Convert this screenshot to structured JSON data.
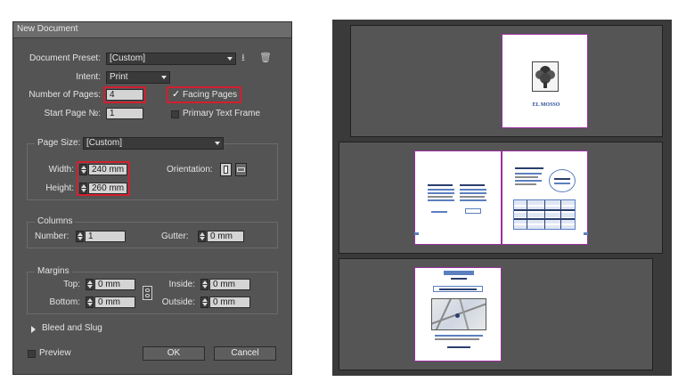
{
  "dialog": {
    "title": "New Document",
    "document_preset": {
      "label": "Document Preset:",
      "value": "[Custom]"
    },
    "intent": {
      "label": "Intent:",
      "value": "Print"
    },
    "number_of_pages": {
      "label": "Number of Pages:",
      "value": "4"
    },
    "facing_pages": {
      "label": "Facing Pages",
      "checked": true
    },
    "start_page": {
      "label": "Start Page №:",
      "value": "1"
    },
    "primary_text_frame": {
      "label": "Primary Text Frame",
      "checked": false
    },
    "page_size": {
      "label": "Page Size:",
      "value": "[Custom]"
    },
    "width": {
      "label": "Width:",
      "value": "240 mm"
    },
    "height": {
      "label": "Height:",
      "value": "260 mm"
    },
    "orientation": {
      "label": "Orientation:"
    },
    "columns": {
      "title": "Columns",
      "number_label": "Number:",
      "number_value": "1",
      "gutter_label": "Gutter:",
      "gutter_value": "0 mm"
    },
    "margins": {
      "title": "Margins",
      "top_label": "Top:",
      "top_value": "0 mm",
      "bottom_label": "Bottom:",
      "bottom_value": "0 mm",
      "inside_label": "Inside:",
      "inside_value": "0 mm",
      "outside_label": "Outside:",
      "outside_value": "0 mm"
    },
    "bleed_and_slug": "Bleed and Slug",
    "preview": {
      "label": "Preview",
      "checked": false
    },
    "ok_label": "OK",
    "cancel_label": "Cancel"
  },
  "canvas": {
    "page1_logo_text": "EL MOSSO"
  },
  "colors": {
    "highlight": "#d21f2f",
    "page_border": "#9b2f9e",
    "accent_blue": "#5b7fbf"
  },
  "icons": [
    "save-preset-icon",
    "delete-preset-icon",
    "chain-link-icon",
    "portrait-orientation-icon",
    "landscape-orientation-icon",
    "disclosure-triangle-icon",
    "checkmark-icon",
    "dropdown-arrow-icon"
  ]
}
